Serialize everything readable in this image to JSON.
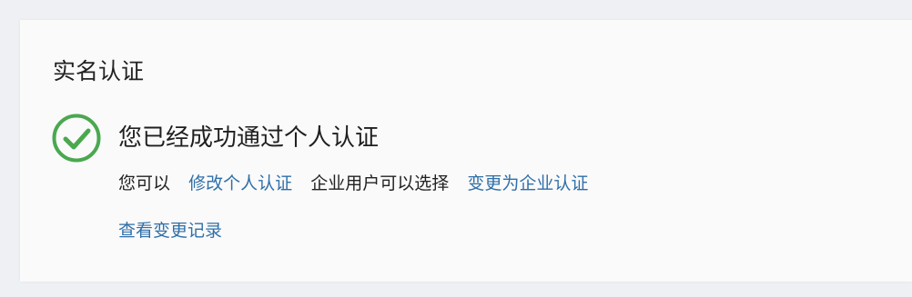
{
  "section": {
    "title": "实名认证"
  },
  "status": {
    "icon": "check-circle-icon",
    "color": "#4aa84f",
    "message": "您已经成功通过个人认证"
  },
  "options": {
    "prefix": "您可以",
    "modify_link": "修改个人认证",
    "middle": "企业用户可以选择",
    "enterprise_link": "变更为企业认证"
  },
  "history": {
    "link": "查看变更记录"
  },
  "colors": {
    "link": "#2f6fa8",
    "success": "#4aa84f"
  }
}
